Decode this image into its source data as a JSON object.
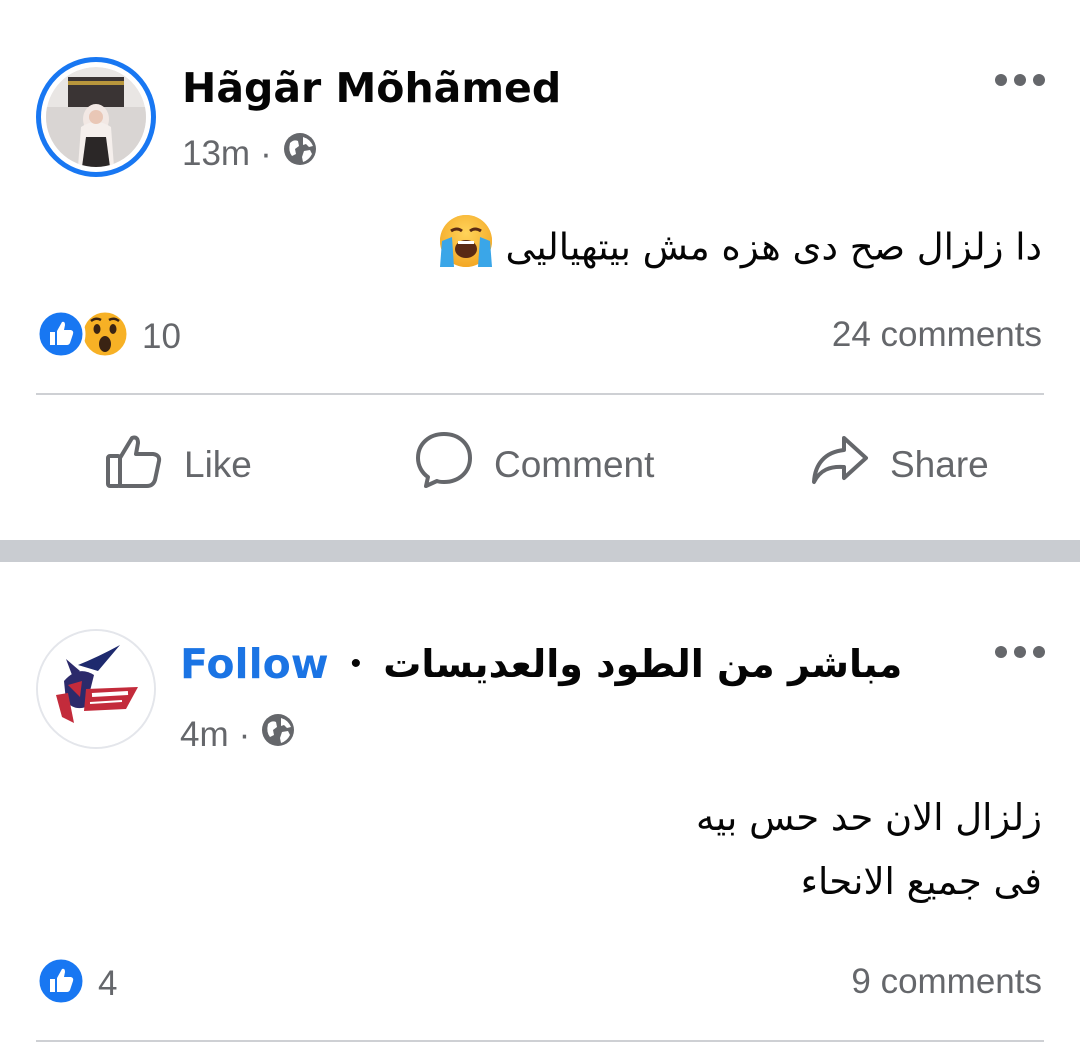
{
  "posts": [
    {
      "author": "Hãgãr Mõhãmed",
      "time": "13m",
      "separator": "·",
      "privacy_icon": "globe-icon",
      "text": "دا زلزال صح دى هزه مش بيتهياليى",
      "text_emoji": "crying-face-emoji",
      "reaction_icons": [
        "like-icon",
        "wow-icon"
      ],
      "reaction_count": "10",
      "comments": "24 comments",
      "actions": {
        "like": "Like",
        "comment": "Comment",
        "share": "Share"
      }
    },
    {
      "page_name": "مباشر من الطود والعديسات",
      "bullet": "•",
      "follow": "Follow",
      "time": "4m",
      "separator": "·",
      "privacy_icon": "globe-icon",
      "text_line1": "زلزال الان حد حس بيه",
      "text_line2": "فى جميع الانحاء",
      "reaction_icons": [
        "like-icon"
      ],
      "reaction_count": "4",
      "comments": "9 comments"
    }
  ],
  "colors": {
    "accent": "#1b74e4",
    "secondary_text": "#65676b",
    "feed_separator": "#c9ccd1",
    "avatar_ring": "#1877f2"
  }
}
